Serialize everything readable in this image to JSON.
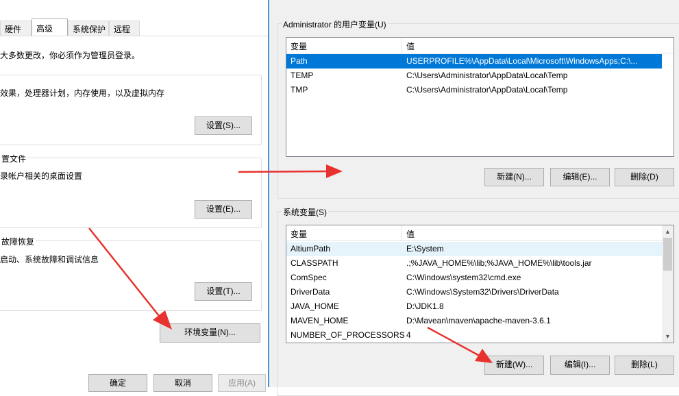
{
  "left": {
    "tabs": [
      "硬件",
      "高级",
      "系统保护",
      "远程"
    ],
    "admin_note": "大多数更改，你必须作为管理员登录。",
    "performance": {
      "desc": "效果，处理器计划，内存使用，以及虚拟内存",
      "button": "设置(S)..."
    },
    "profile": {
      "label": "置文件",
      "desc": "录帐户相关的桌面设置",
      "button": "设置(E)..."
    },
    "startup": {
      "label": "故障恢复",
      "desc": "启动、系统故障和调试信息",
      "button": "设置(T)..."
    },
    "env_button": "环境变量(N)...",
    "footer": {
      "ok": "确定",
      "cancel": "取消",
      "apply": "应用(A)"
    }
  },
  "right": {
    "user_vars": {
      "label": "Administrator 的用户变量(U)",
      "col_var": "变量",
      "col_val": "值",
      "rows": [
        {
          "name": "Path",
          "value": "USERPROFILE%\\AppData\\Local\\Microsoft\\WindowsApps;C:\\...",
          "selected": true
        },
        {
          "name": "TEMP",
          "value": "C:\\Users\\Administrator\\AppData\\Local\\Temp"
        },
        {
          "name": "TMP",
          "value": "C:\\Users\\Administrator\\AppData\\Local\\Temp"
        }
      ],
      "new_button": "新建(N)...",
      "edit_button": "编辑(E)...",
      "delete_button": "删除(D)"
    },
    "sys_vars": {
      "label": "系统变量(S)",
      "col_var": "变量",
      "col_val": "值",
      "rows": [
        {
          "name": "AltiumPath",
          "value": "E:\\System"
        },
        {
          "name": "CLASSPATH",
          "value": ".;%JAVA_HOME%\\lib;%JAVA_HOME%\\lib\\tools.jar"
        },
        {
          "name": "ComSpec",
          "value": "C:\\Windows\\system32\\cmd.exe"
        },
        {
          "name": "DriverData",
          "value": "C:\\Windows\\System32\\Drivers\\DriverData"
        },
        {
          "name": "JAVA_HOME",
          "value": "D:\\JDK1.8"
        },
        {
          "name": "MAVEN_HOME",
          "value": "D:\\Mavean\\maven\\apache-maven-3.6.1"
        },
        {
          "name": "NUMBER_OF_PROCESSORS",
          "value": "4"
        }
      ],
      "new_button": "新建(W)...",
      "edit_button": "编辑(I)...",
      "delete_button": "删除(L)"
    }
  },
  "colors": {
    "annotation_arrow": "#e8322e",
    "selection": "#0078d7",
    "divider": "#4a8fd8"
  },
  "icons": {
    "scroll_up": "scroll-up-arrow-icon",
    "scroll_down": "scroll-down-arrow-icon"
  }
}
